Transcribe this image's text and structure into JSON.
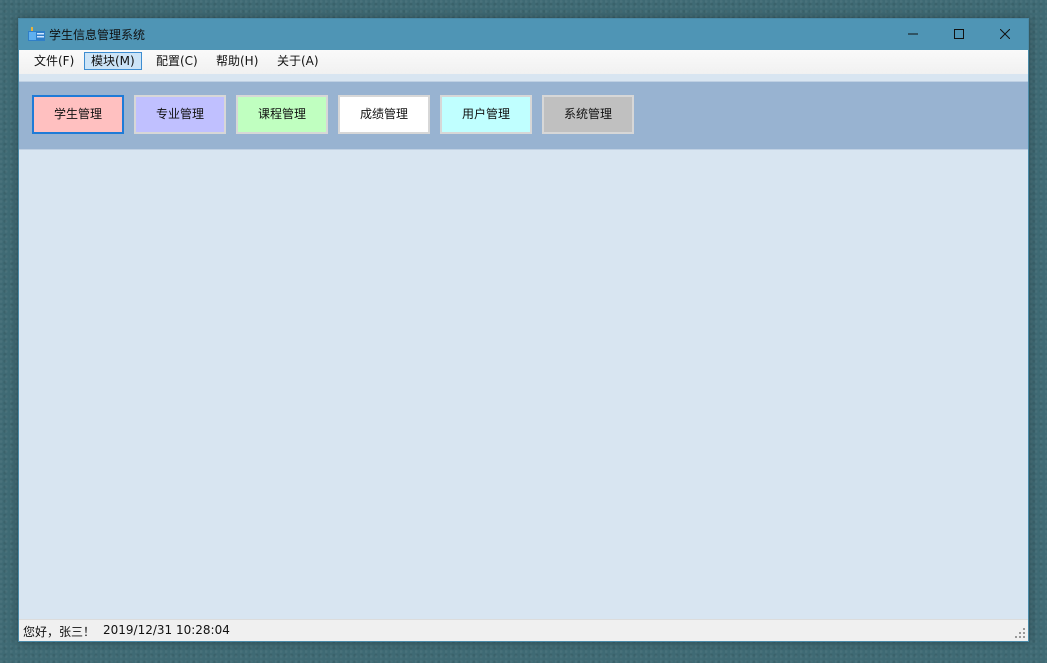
{
  "window": {
    "title": "学生信息管理系统",
    "app_icon": "app-icon"
  },
  "menubar": {
    "items": [
      {
        "label": "文件(F)"
      },
      {
        "label": "模块(M)",
        "active": true
      },
      {
        "label": "配置(C)"
      },
      {
        "label": "帮助(H)"
      },
      {
        "label": "关于(A)"
      }
    ]
  },
  "toolbar": {
    "buttons": [
      {
        "label": "学生管理",
        "color": "#ffc0c0",
        "focused": true
      },
      {
        "label": "专业管理",
        "color": "#c0c0ff"
      },
      {
        "label": "课程管理",
        "color": "#c0ffc0"
      },
      {
        "label": "成绩管理",
        "color": "#ffffff"
      },
      {
        "label": "用户管理",
        "color": "#c0ffff"
      },
      {
        "label": "系统管理",
        "color": "#c0c0c0"
      }
    ]
  },
  "statusbar": {
    "greeting": "您好，张三！",
    "datetime": "2019/12/31 10:28:04"
  },
  "colors": {
    "titlebar": "#4f95b5",
    "toolbar": "#98b3d1",
    "content": "#d8e5f1",
    "focus_border": "#1f7bd7",
    "menu_highlight": "#cce4f7"
  }
}
